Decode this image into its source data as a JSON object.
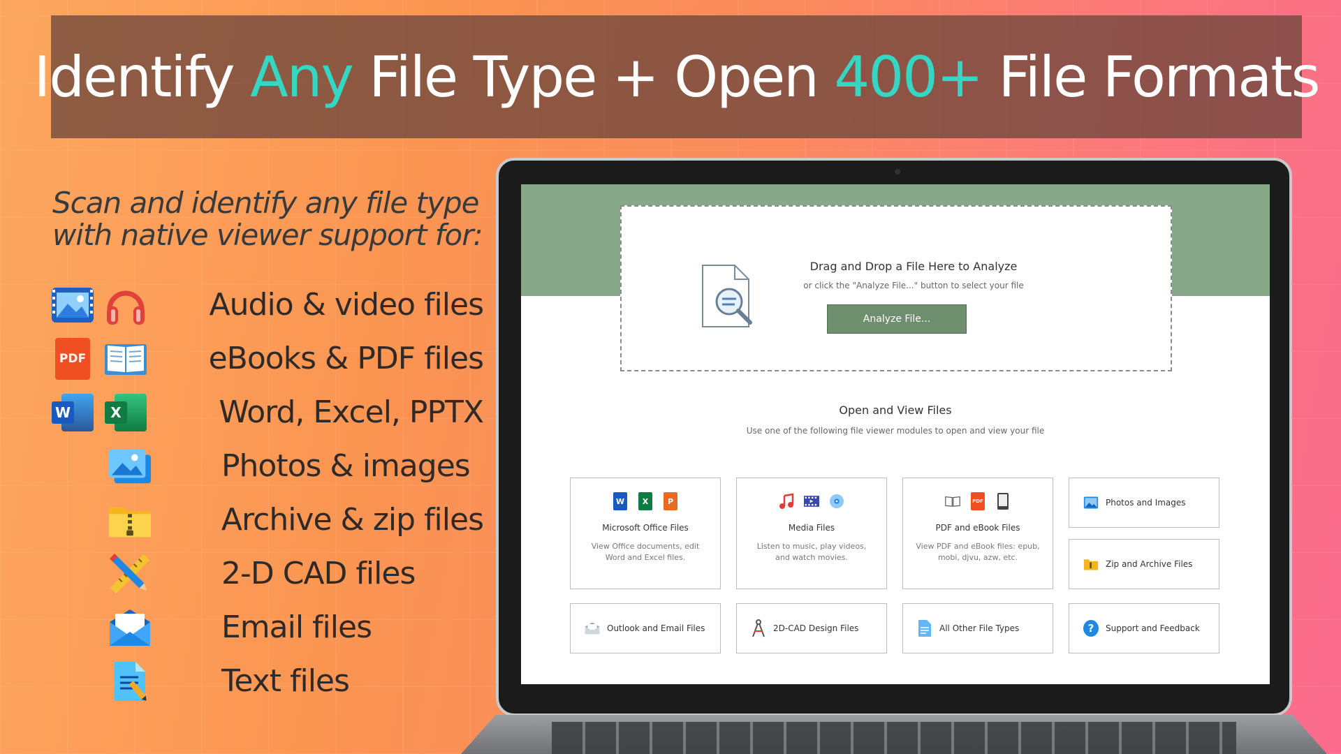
{
  "banner": {
    "part1": "Identify ",
    "accent1": "Any",
    "part2": " File Type + Open ",
    "accent2": "400+",
    "part3": " File Formats"
  },
  "tagline": {
    "line1": "Scan and identify any file type",
    "line2": "with native viewer support for:"
  },
  "features": [
    {
      "label": "Audio & video files",
      "icons": [
        "video-icon",
        "headphones-icon"
      ]
    },
    {
      "label": "eBooks & PDF files",
      "icons": [
        "pdf-icon",
        "book-icon"
      ],
      "pdf_text": "PDF"
    },
    {
      "label": "Word, Excel, PPTX",
      "icons": [
        "word-icon",
        "excel-icon"
      ],
      "word_letter": "W",
      "excel_letter": "X"
    },
    {
      "label": "Photos & images",
      "icons": [
        "image-icon"
      ]
    },
    {
      "label": "Archive & zip files",
      "icons": [
        "zip-folder-icon"
      ]
    },
    {
      "label": "2-D CAD files",
      "icons": [
        "cad-tools-icon"
      ]
    },
    {
      "label": "Email files",
      "icons": [
        "email-icon"
      ]
    },
    {
      "label": "Text files",
      "icons": [
        "text-file-icon"
      ]
    }
  ],
  "app": {
    "drop_title": "Drag and Drop a File Here to Analyze",
    "drop_sub": "or click the \"Analyze File...\" button to select your file",
    "analyze_button": "Analyze File...",
    "open_view_title": "Open and View Files",
    "open_view_sub": "Use one of the following file viewer modules to open and view your file",
    "cards": {
      "office": {
        "title": "Microsoft Office Files",
        "desc": "View Office documents, edit Word and Excel files.",
        "letters": [
          "W",
          "X",
          "P"
        ]
      },
      "media": {
        "title": "Media Files",
        "desc": "Listen to music, play videos, and watch movies."
      },
      "pdf": {
        "title": "PDF and eBook Files",
        "desc": "View PDF and eBook files: epub, mobi, djvu, azw, etc.",
        "pdf_text": "PDF"
      },
      "photos": {
        "title": "Photos and Images"
      },
      "zip": {
        "title": "Zip and Archive Files"
      },
      "outlook": {
        "title": "Outlook and Email Files"
      },
      "cad": {
        "title": "2D-CAD Design Files"
      },
      "other": {
        "title": "All Other File Types"
      },
      "support": {
        "title": "Support and Feedback",
        "glyph": "?"
      }
    }
  },
  "colors": {
    "accent": "#36d6c4",
    "app_green": "#88a88a",
    "button_green": "#6e8f6e"
  }
}
